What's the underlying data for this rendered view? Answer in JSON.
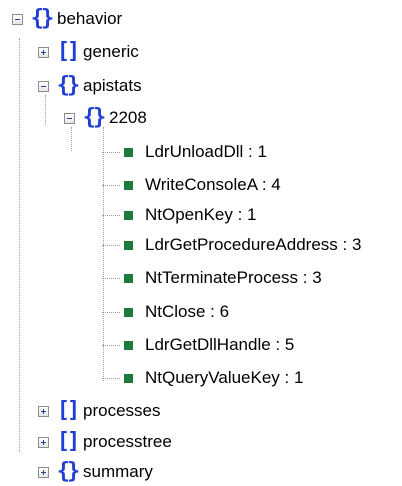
{
  "tree": {
    "behavior": {
      "label": "behavior",
      "children": {
        "generic": "generic",
        "apistats": {
          "label": "apistats",
          "children": {
            "pid_2208": {
              "label": "2208",
              "leaves": [
                "LdrUnloadDll : 1",
                "WriteConsoleA : 4",
                "NtOpenKey : 1",
                "LdrGetProcedureAddress : 3",
                "NtTerminateProcess : 3",
                "NtClose : 6",
                "LdrGetDllHandle : 5",
                "NtQueryValueKey : 1"
              ]
            }
          }
        },
        "processes": "processes",
        "processtree": "processtree",
        "summary": "summary"
      }
    }
  },
  "colors": {
    "bracket": "#1f3fd6",
    "leaf_square": "#1c7a3c",
    "guide": "#9b9b9b"
  },
  "icons": {
    "expanded": "minus-toggle-icon",
    "collapsed": "plus-toggle-icon",
    "object": "curly-braces-icon",
    "array": "square-brackets-icon",
    "value": "green-square-icon"
  }
}
